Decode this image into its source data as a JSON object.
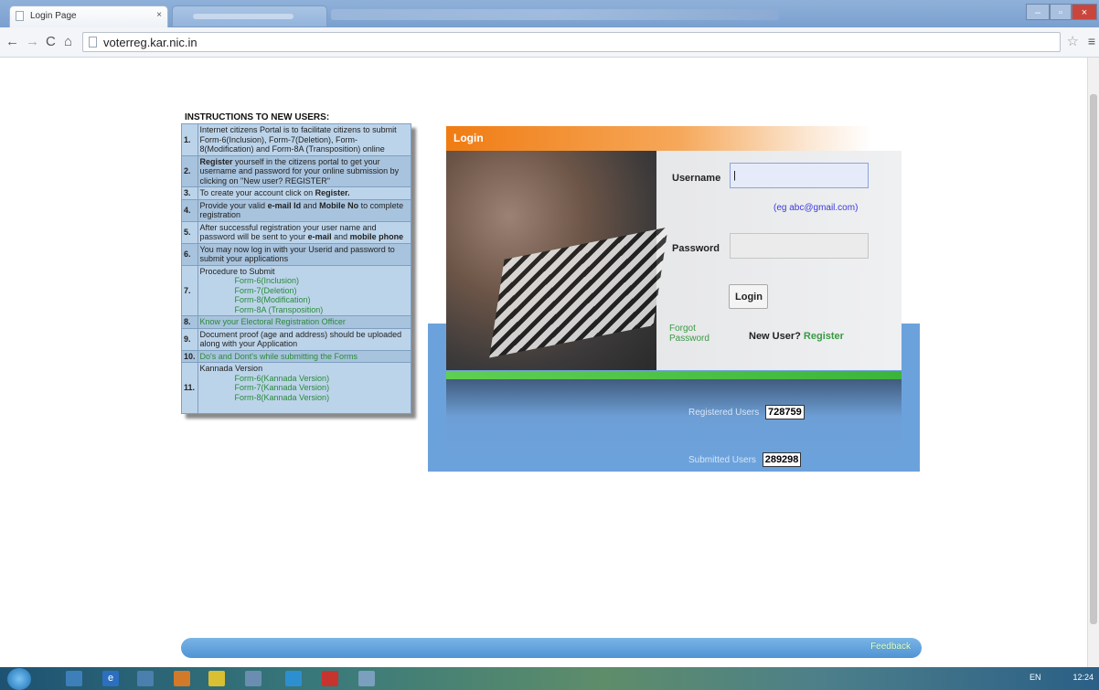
{
  "browser": {
    "tab_title": "Login Page",
    "tab_close": "×",
    "url": "voterreg.kar.nic.in",
    "icons": [
      "back-icon",
      "forward-icon",
      "reload-icon",
      "home-icon",
      "star-icon",
      "menu-icon"
    ]
  },
  "instructions": {
    "title": "INSTRUCTIONS TO NEW USERS:",
    "items": [
      {
        "num": "1.",
        "text": "Internet citizens Portal is to facilitate citizens to submit Form-6(Inclusion), Form-7(Deletion), Form-8(Modification) and Form-8A (Transposition) online"
      },
      {
        "num": "2.",
        "bold": "Register",
        "text": " yourself in the citizens portal to get your username and password for your online submission by clicking on \"New user? REGISTER\""
      },
      {
        "num": "3.",
        "text": "To create your account click on ",
        "bold": "Register."
      },
      {
        "num": "4.",
        "pre": "Provide your valid ",
        "bold1": "e-mail Id",
        "mid": " and ",
        "bold2": "Mobile No",
        "post": " to complete registration"
      },
      {
        "num": "5.",
        "pre": "After successful registration your user name and password will be sent to your ",
        "bold1": "e-mail",
        "mid": " and ",
        "bold2": "mobile phone"
      },
      {
        "num": "6.",
        "text": "You may now log in with your Userid and password to submit your applications"
      },
      {
        "num": "7.",
        "text": "Procedure to Submit",
        "links": [
          "Form-6(Inclusion)",
          "Form-7(Deletion)",
          "Form-8(Modification)",
          "Form-8A (Transposition)"
        ]
      },
      {
        "num": "8.",
        "link": "Know your Electoral Registration Officer"
      },
      {
        "num": "9.",
        "text": "Document proof (age and address) should be uploaded along with your Application"
      },
      {
        "num": "10.",
        "link": "Do's and Dont's while submitting the Forms"
      },
      {
        "num": "11.",
        "text": "Kannada Version",
        "links": [
          "Form-6(Kannada Version)",
          "Form-7(Kannada Version)",
          "Form-8(Kannada Version)"
        ]
      }
    ]
  },
  "login": {
    "title": "Login",
    "username_label": "Username",
    "username_value": "|",
    "username_hint": "(eg abc@gmail.com)",
    "password_label": "Password",
    "password_value": "",
    "button": "Login",
    "forgot": "Forgot Password",
    "new_user": "New User?",
    "register": "Register"
  },
  "stats": {
    "registered_label": "Registered Users",
    "registered_value": "728759",
    "submitted_label": "Submitted Users",
    "submitted_value": "289298"
  },
  "footer": {
    "feedback": "Feedback"
  },
  "taskbar": {
    "lang": "EN",
    "time": "12:24"
  }
}
